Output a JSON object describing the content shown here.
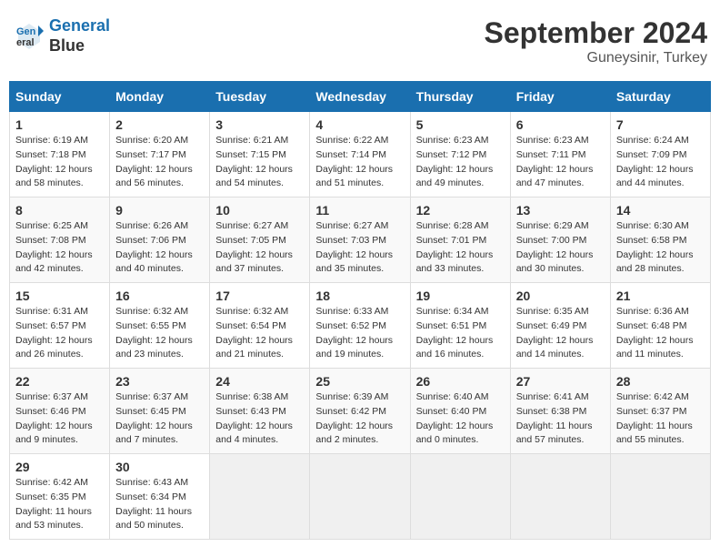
{
  "header": {
    "logo_line1": "General",
    "logo_line2": "Blue",
    "month": "September 2024",
    "location": "Guneysinir, Turkey"
  },
  "days_of_week": [
    "Sunday",
    "Monday",
    "Tuesday",
    "Wednesday",
    "Thursday",
    "Friday",
    "Saturday"
  ],
  "weeks": [
    [
      {
        "day": "1",
        "info": "Sunrise: 6:19 AM\nSunset: 7:18 PM\nDaylight: 12 hours\nand 58 minutes."
      },
      {
        "day": "2",
        "info": "Sunrise: 6:20 AM\nSunset: 7:17 PM\nDaylight: 12 hours\nand 56 minutes."
      },
      {
        "day": "3",
        "info": "Sunrise: 6:21 AM\nSunset: 7:15 PM\nDaylight: 12 hours\nand 54 minutes."
      },
      {
        "day": "4",
        "info": "Sunrise: 6:22 AM\nSunset: 7:14 PM\nDaylight: 12 hours\nand 51 minutes."
      },
      {
        "day": "5",
        "info": "Sunrise: 6:23 AM\nSunset: 7:12 PM\nDaylight: 12 hours\nand 49 minutes."
      },
      {
        "day": "6",
        "info": "Sunrise: 6:23 AM\nSunset: 7:11 PM\nDaylight: 12 hours\nand 47 minutes."
      },
      {
        "day": "7",
        "info": "Sunrise: 6:24 AM\nSunset: 7:09 PM\nDaylight: 12 hours\nand 44 minutes."
      }
    ],
    [
      {
        "day": "8",
        "info": "Sunrise: 6:25 AM\nSunset: 7:08 PM\nDaylight: 12 hours\nand 42 minutes."
      },
      {
        "day": "9",
        "info": "Sunrise: 6:26 AM\nSunset: 7:06 PM\nDaylight: 12 hours\nand 40 minutes."
      },
      {
        "day": "10",
        "info": "Sunrise: 6:27 AM\nSunset: 7:05 PM\nDaylight: 12 hours\nand 37 minutes."
      },
      {
        "day": "11",
        "info": "Sunrise: 6:27 AM\nSunset: 7:03 PM\nDaylight: 12 hours\nand 35 minutes."
      },
      {
        "day": "12",
        "info": "Sunrise: 6:28 AM\nSunset: 7:01 PM\nDaylight: 12 hours\nand 33 minutes."
      },
      {
        "day": "13",
        "info": "Sunrise: 6:29 AM\nSunset: 7:00 PM\nDaylight: 12 hours\nand 30 minutes."
      },
      {
        "day": "14",
        "info": "Sunrise: 6:30 AM\nSunset: 6:58 PM\nDaylight: 12 hours\nand 28 minutes."
      }
    ],
    [
      {
        "day": "15",
        "info": "Sunrise: 6:31 AM\nSunset: 6:57 PM\nDaylight: 12 hours\nand 26 minutes."
      },
      {
        "day": "16",
        "info": "Sunrise: 6:32 AM\nSunset: 6:55 PM\nDaylight: 12 hours\nand 23 minutes."
      },
      {
        "day": "17",
        "info": "Sunrise: 6:32 AM\nSunset: 6:54 PM\nDaylight: 12 hours\nand 21 minutes."
      },
      {
        "day": "18",
        "info": "Sunrise: 6:33 AM\nSunset: 6:52 PM\nDaylight: 12 hours\nand 19 minutes."
      },
      {
        "day": "19",
        "info": "Sunrise: 6:34 AM\nSunset: 6:51 PM\nDaylight: 12 hours\nand 16 minutes."
      },
      {
        "day": "20",
        "info": "Sunrise: 6:35 AM\nSunset: 6:49 PM\nDaylight: 12 hours\nand 14 minutes."
      },
      {
        "day": "21",
        "info": "Sunrise: 6:36 AM\nSunset: 6:48 PM\nDaylight: 12 hours\nand 11 minutes."
      }
    ],
    [
      {
        "day": "22",
        "info": "Sunrise: 6:37 AM\nSunset: 6:46 PM\nDaylight: 12 hours\nand 9 minutes."
      },
      {
        "day": "23",
        "info": "Sunrise: 6:37 AM\nSunset: 6:45 PM\nDaylight: 12 hours\nand 7 minutes."
      },
      {
        "day": "24",
        "info": "Sunrise: 6:38 AM\nSunset: 6:43 PM\nDaylight: 12 hours\nand 4 minutes."
      },
      {
        "day": "25",
        "info": "Sunrise: 6:39 AM\nSunset: 6:42 PM\nDaylight: 12 hours\nand 2 minutes."
      },
      {
        "day": "26",
        "info": "Sunrise: 6:40 AM\nSunset: 6:40 PM\nDaylight: 12 hours\nand 0 minutes."
      },
      {
        "day": "27",
        "info": "Sunrise: 6:41 AM\nSunset: 6:38 PM\nDaylight: 11 hours\nand 57 minutes."
      },
      {
        "day": "28",
        "info": "Sunrise: 6:42 AM\nSunset: 6:37 PM\nDaylight: 11 hours\nand 55 minutes."
      }
    ],
    [
      {
        "day": "29",
        "info": "Sunrise: 6:42 AM\nSunset: 6:35 PM\nDaylight: 11 hours\nand 53 minutes."
      },
      {
        "day": "30",
        "info": "Sunrise: 6:43 AM\nSunset: 6:34 PM\nDaylight: 11 hours\nand 50 minutes."
      },
      {
        "day": "",
        "info": ""
      },
      {
        "day": "",
        "info": ""
      },
      {
        "day": "",
        "info": ""
      },
      {
        "day": "",
        "info": ""
      },
      {
        "day": "",
        "info": ""
      }
    ]
  ]
}
